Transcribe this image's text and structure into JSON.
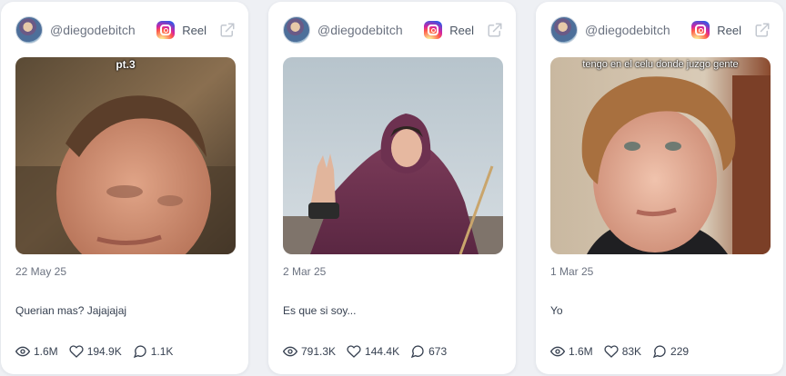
{
  "posts": [
    {
      "handle": "@diegodebitch",
      "type_label": "Reel",
      "overlay_text": "pt.3",
      "date": "22 May 25",
      "caption": "Querian mas? Jajajajaj",
      "views": "1.6M",
      "likes": "194.9K",
      "comments": "1.1K"
    },
    {
      "handle": "@diegodebitch",
      "type_label": "Reel",
      "overlay_text": "",
      "date": "2 Mar 25",
      "caption": "Es que si soy...",
      "views": "791.3K",
      "likes": "144.4K",
      "comments": "673"
    },
    {
      "handle": "@diegodebitch",
      "type_label": "Reel",
      "overlay_text": "tengo en el celu donde juzgo gente",
      "date": "1 Mar 25",
      "caption": "Yo",
      "views": "1.6M",
      "likes": "83K",
      "comments": "229"
    }
  ],
  "icons": {
    "platform": "instagram-icon",
    "external": "external-link-icon",
    "views": "eye-icon",
    "likes": "heart-icon",
    "comments": "comment-icon"
  },
  "colors": {
    "background": "#eef0f4",
    "card": "#ffffff",
    "muted_text": "#6b7280",
    "body_text": "#374151"
  }
}
